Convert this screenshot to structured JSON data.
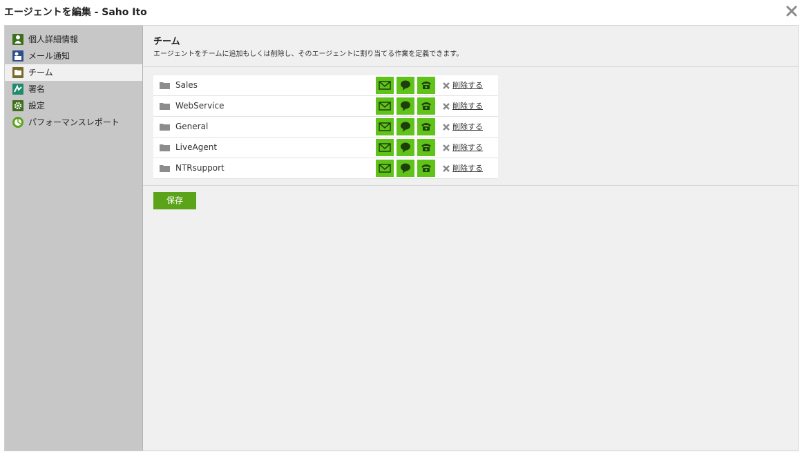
{
  "window": {
    "title": "エージェントを編集 - Saho Ito"
  },
  "sidebar": {
    "items": [
      {
        "label": "個人詳細情報",
        "icon": "person-icon"
      },
      {
        "label": "メール通知",
        "icon": "mail-notify-icon"
      },
      {
        "label": "チーム",
        "icon": "team-folder-icon",
        "active": true
      },
      {
        "label": "署名",
        "icon": "signature-icon"
      },
      {
        "label": "設定",
        "icon": "gear-icon"
      },
      {
        "label": "パフォーマンスレポート",
        "icon": "performance-icon"
      }
    ]
  },
  "section": {
    "title": "チーム",
    "description": "エージェントをチームに追加もしくは削除し、そのエージェントに割り当てる作業を定義できます。"
  },
  "teams": [
    {
      "name": "Sales",
      "remove_label": "削除する"
    },
    {
      "name": "WebService",
      "remove_label": "削除する"
    },
    {
      "name": "General",
      "remove_label": "削除する"
    },
    {
      "name": "LiveAgent",
      "remove_label": "削除する"
    },
    {
      "name": "NTRsupport",
      "remove_label": "削除する"
    }
  ],
  "channels": [
    "email-icon",
    "chat-icon",
    "phone-icon"
  ],
  "colors": {
    "channel_green": "#5fc31a",
    "save_green": "#5ba318",
    "sidebar_bg": "#c7c7c7",
    "content_bg": "#f0f0f0"
  },
  "save_label": "保存"
}
